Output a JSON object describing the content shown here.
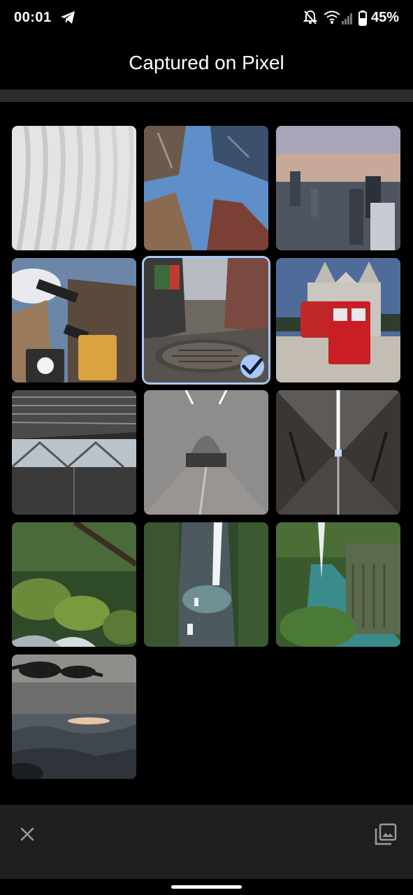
{
  "status_bar": {
    "time": "00:01",
    "battery_percent": "45%",
    "icons": [
      "telegram-icon",
      "notifications-off-icon",
      "wifi-icon",
      "cell-signal-icon",
      "battery-icon"
    ]
  },
  "header": {
    "title": "Captured on Pixel"
  },
  "grid": {
    "photos": [
      {
        "subject": "white curved architecture ribs",
        "selected": false
      },
      {
        "subject": "skyscrapers looking up at blue sky",
        "selected": false
      },
      {
        "subject": "city skyline at sunset",
        "selected": false
      },
      {
        "subject": "street signs and traffic light",
        "selected": false
      },
      {
        "subject": "manhole cover on street",
        "selected": true
      },
      {
        "subject": "red telephone box and bus near cathedral",
        "selected": false
      },
      {
        "subject": "modern station hall with ceiling slats",
        "selected": false
      },
      {
        "subject": "underground station tunnel",
        "selected": false
      },
      {
        "subject": "long white corridor",
        "selected": false
      },
      {
        "subject": "mossy forest stream",
        "selected": false
      },
      {
        "subject": "gorge waterfall with boats",
        "selected": false
      },
      {
        "subject": "green gorge river",
        "selected": false
      },
      {
        "subject": "tree silhouette over misty mountains",
        "selected": false
      }
    ]
  },
  "bottom_bar": {
    "close_icon": "close-icon",
    "gallery_icon": "photo-library-icon"
  },
  "colors": {
    "selection": "#a8c7fa",
    "bottom_bar": "#1f1f1f",
    "divider": "#2b2b2b"
  }
}
